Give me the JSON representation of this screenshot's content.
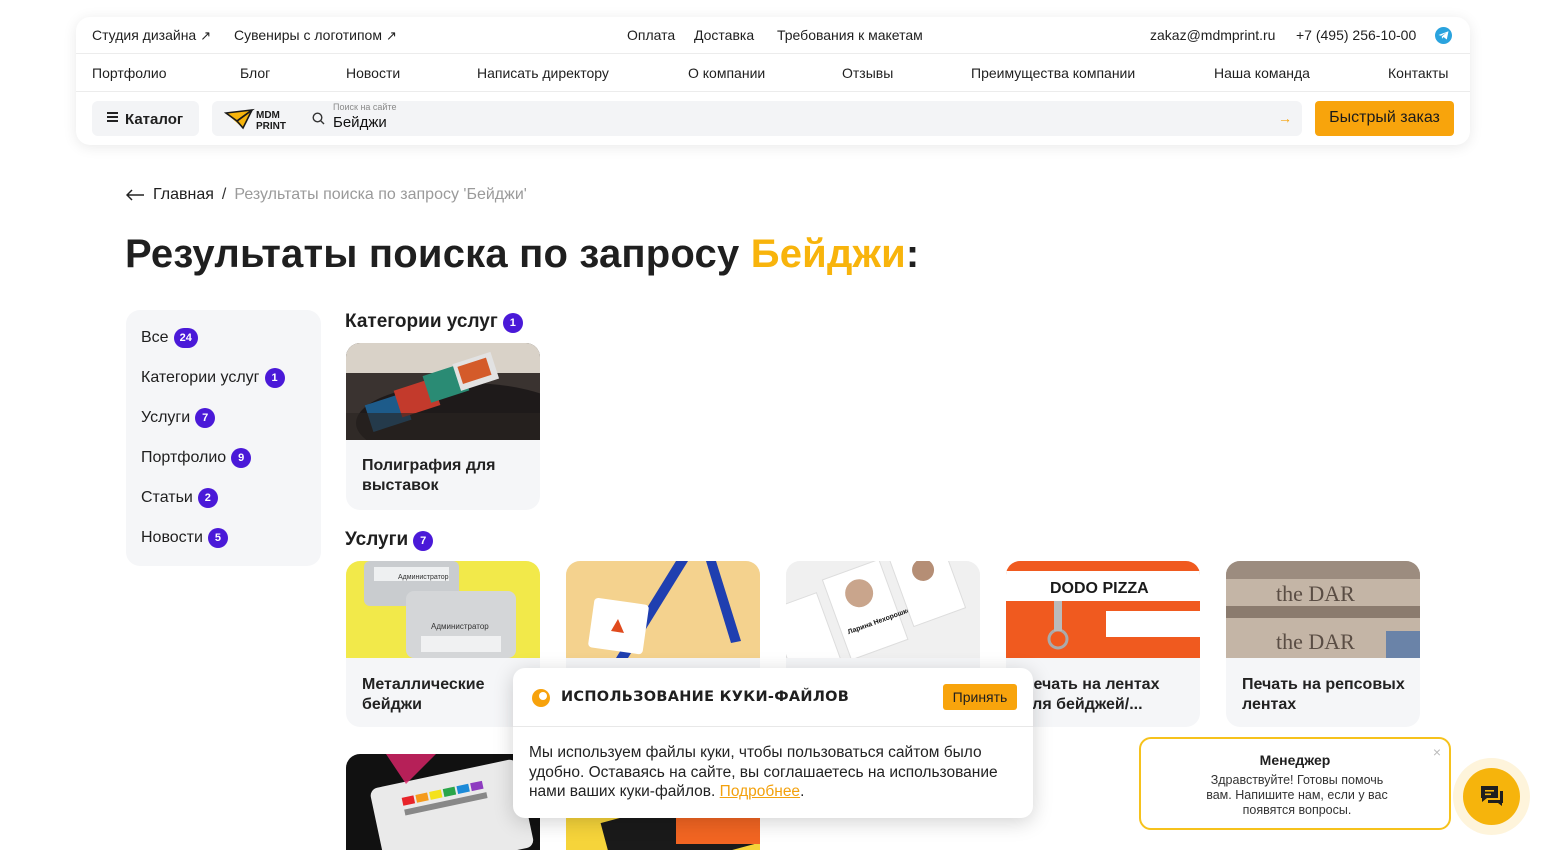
{
  "header": {
    "top_links": [
      {
        "label": "Студия дизайна",
        "arrow": "↗"
      },
      {
        "label": "Сувениры с логотипом",
        "arrow": "↗"
      },
      {
        "label": "Оплата"
      },
      {
        "label": "Доставка"
      },
      {
        "label": "Требования к макетам"
      },
      {
        "label": "zakaz@mdmprint.ru"
      },
      {
        "label": "+7 (495) 256-10-00"
      }
    ],
    "nav": [
      "Портфолио",
      "Блог",
      "Новости",
      "Написать директору",
      "О компании",
      "Отзывы",
      "Преимущества компании",
      "Наша команда",
      "Контакты"
    ],
    "catalog_label": "Каталог",
    "logo_line1": "MDM",
    "logo_line2": "PRINT",
    "search_placeholder": "Поиск на сайте",
    "search_value": "Бейджи",
    "quick_order_label": "Быстрый заказ"
  },
  "breadcrumbs": {
    "home": "Главная",
    "separator": "/",
    "current": "Результаты поиска по запросу 'Бейджи'"
  },
  "page_title": {
    "prefix": "Результаты поиска по запросу",
    "query": "Бейджи",
    "suffix": ":"
  },
  "filters": [
    {
      "label": "Все",
      "count": "24"
    },
    {
      "label": "Категории услуг",
      "count": "1"
    },
    {
      "label": "Услуги",
      "count": "7"
    },
    {
      "label": "Портфолио",
      "count": "9"
    },
    {
      "label": "Статьи",
      "count": "2"
    },
    {
      "label": "Новости",
      "count": "5"
    }
  ],
  "sections": {
    "categories": {
      "title": "Категории услуг",
      "count": "1",
      "cards": [
        {
          "title": "Полиграфия для выставок",
          "line1": "Полиграфия для",
          "line2": "выставок"
        }
      ]
    },
    "services": {
      "title": "Услуги",
      "count": "7",
      "cards": [
        {
          "line1": "Металлические",
          "line2": "бейджи"
        },
        {
          "line1": "",
          "line2": ""
        },
        {
          "line1": "",
          "line2": ""
        },
        {
          "line1": "Печать на лентах",
          "line2": "для бейджей/..."
        },
        {
          "line1": "Печать на репсовых",
          "line2": "лентах"
        }
      ],
      "image_texts": [
        "Администратор",
        "DODO PIZZA",
        "the DAR",
        "Ларина Нехорошкова"
      ]
    }
  },
  "cookie_banner": {
    "title": "ИСПОЛЬЗОВАНИЕ КУКИ-ФАЙЛОВ",
    "accept_label": "Принять",
    "text": "Мы используем файлы куки, чтобы пользоваться сайтом было удобно. Оставаясь на сайте, вы соглашаетесь на использование нами ваших куки-файлов.",
    "link_label": "Подробнее"
  },
  "chat_widget": {
    "title": "Менеджер",
    "message": "Здравствуйте! Готовы помочь вам. Напишите нам, если у вас появятся вопросы.",
    "close": "×"
  },
  "colors": {
    "accent": "#f8a40c",
    "highlight": "#f8b40c",
    "badge": "#4a19d8",
    "telegram": "#2aa3de"
  }
}
